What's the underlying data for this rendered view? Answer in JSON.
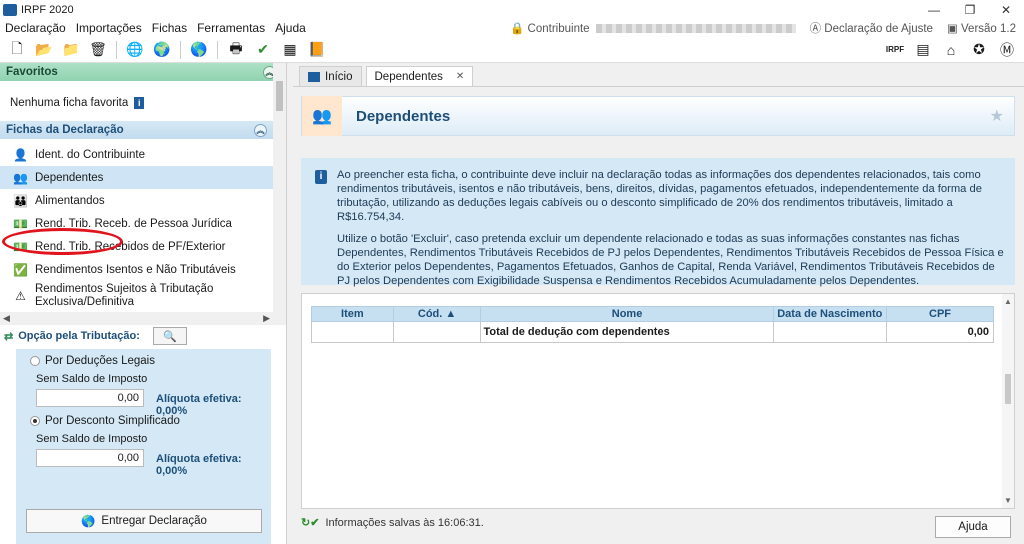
{
  "window": {
    "title": "IRPF 2020",
    "controls": [
      "—",
      "❐",
      "✕"
    ]
  },
  "menu": {
    "items": [
      "Declaração",
      "Importações",
      "Fichas",
      "Ferramentas",
      "Ajuda"
    ],
    "contribuinte_label": "Contribuinte",
    "declaracao_label": "Declaração de Ajuste",
    "versao_label": "Versão 1.2"
  },
  "favoritos": {
    "title": "Favoritos",
    "empty_text": "Nenhuma ficha favorita"
  },
  "fichas": {
    "title": "Fichas da Declaração",
    "items": [
      {
        "label": "Ident. do Contribuinte",
        "icon": "👤"
      },
      {
        "label": "Dependentes",
        "icon": "👥"
      },
      {
        "label": "Alimentandos",
        "icon": "👪"
      },
      {
        "label": "Rend. Trib. Receb. de Pessoa Jurídica",
        "icon": "💵"
      },
      {
        "label": "Rend. Trib. Recebidos de PF/Exterior",
        "icon": "💵"
      },
      {
        "label": "Rendimentos Isentos e Não Tributáveis",
        "icon": "✅"
      },
      {
        "label": "Rendimentos Sujeitos à Tributação Exclusiva/Definitiva",
        "icon": "⚠"
      }
    ]
  },
  "opcao": {
    "title": "Opção pela Tributação:",
    "deducoes_label": "Por Deduções Legais",
    "deducoes_saldo": "Sem Saldo de Imposto",
    "deducoes_valor": "0,00",
    "deducoes_aliquota": "Alíquota efetiva: 0,00%",
    "simplificado_label": "Por Desconto Simplificado",
    "simplificado_saldo": "Sem Saldo de Imposto",
    "simplificado_valor": "0,00",
    "simplificado_aliquota": "Alíquota efetiva: 0,00%",
    "entregar_label": "Entregar Declaração"
  },
  "tabs": {
    "inicio": "Início",
    "dependentes": "Dependentes"
  },
  "page": {
    "title": "Dependentes",
    "info_p1": "Ao preencher esta ficha, o contribuinte deve incluir na declaração todas as informações dos dependentes relacionados, tais como rendimentos tributáveis, isentos e não tributáveis, bens, direitos, dívidas, pagamentos efetuados, independentemente da forma de tributação, utilizando as deduções legais cabíveis ou o desconto simplificado de 20% dos rendimentos tributáveis, limitado a R$16.754,34.",
    "info_p2": "Utilize o botão 'Excluir', caso pretenda excluir um dependente relacionado e todas as suas informações constantes nas fichas Dependentes, Rendimentos Tributáveis Recebidos de PJ pelos Dependentes, Rendimentos Tributáveis Recebidos de Pessoa Física e do Exterior pelos Dependentes, Pagamentos Efetuados, Ganhos de Capital, Renda Variável, Rendimentos Tributáveis Recebidos de PJ pelos Dependentes com Exigibilidade Suspensa e Rendimentos Recebidos Acumuladamente pelos Dependentes."
  },
  "table": {
    "headers": [
      "Item",
      "Cód. ▲",
      "Nome",
      "Data de Nascimento",
      "CPF"
    ],
    "total_label": "Total de dedução com dependentes",
    "total_value": "0,00"
  },
  "status": {
    "text": "Informações salvas às 16:06:31.",
    "ajuda_label": "Ajuda"
  }
}
